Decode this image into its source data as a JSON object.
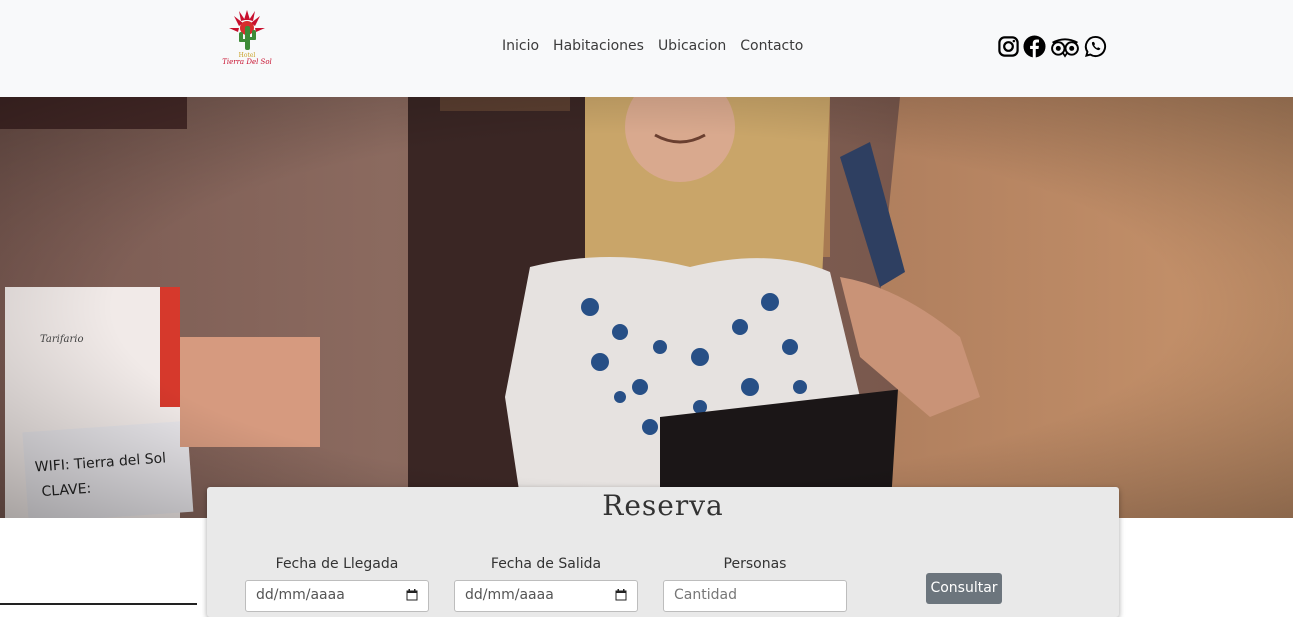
{
  "brand": {
    "logo_line1": "Hotel",
    "logo_line2": "Tierra Del Sol"
  },
  "nav": {
    "items": [
      "Inicio",
      "Habitaciones",
      "Ubicacion",
      "Contacto"
    ]
  },
  "socials": [
    "instagram-icon",
    "facebook-icon",
    "tripadvisor-icon",
    "whatsapp-icon"
  ],
  "hero": {
    "sign_heading": "Tarifario",
    "wifi_line": "WIFI: Tierra del Sol",
    "clave_line": "CLAVE:"
  },
  "reserva": {
    "title": "Reserva",
    "checkin_label": "Fecha de Llegada",
    "checkin_value": "dd/mm/aaaa",
    "checkout_label": "Fecha de Salida",
    "checkout_value": "dd/mm/aaaa",
    "guests_label": "Personas",
    "guests_placeholder": "Cantidad",
    "submit_label": "Consultar"
  },
  "colors": {
    "navbar_bg": "#f8f9fa",
    "button_bg": "#6c757d",
    "form_bg": "#e9e9e9",
    "logo_red": "#c8102e"
  }
}
